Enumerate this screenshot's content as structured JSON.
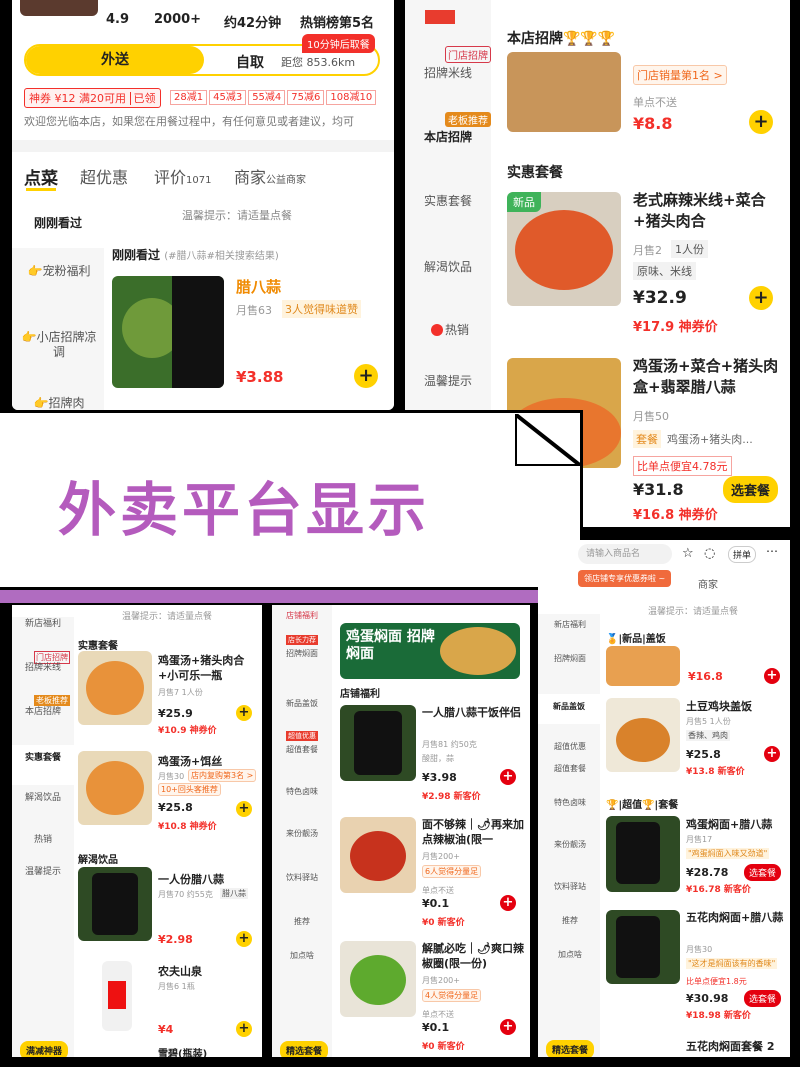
{
  "p1": {
    "stats": [
      "4.9",
      "2000+",
      "约42分钟",
      "热销榜第5名"
    ],
    "delivery_tab": "外送",
    "pickup_tab": "自取",
    "distance": "距您 853.6km",
    "pickup_badge": "10分钟后取餐",
    "coupon_main": "神券 ¥12 满20可用",
    "coupon_status": "已领",
    "discounts": [
      "28减1",
      "45减3",
      "55减4",
      "75减6",
      "108减10"
    ],
    "notice": "欢迎您光临本店，如果您在用餐过程中，有任何意见或者建议，均可",
    "tabs": [
      "点菜",
      "超优惠",
      "评价",
      "商家"
    ],
    "review_count": "1071",
    "merchant_sub": "公益商家",
    "sidebar": [
      "刚刚看过",
      "👉宠粉福利",
      "👉小店招牌凉调",
      "👉招牌肉"
    ],
    "hint": "温馨提示：请适量点餐",
    "section_title": "刚刚看过",
    "section_sub": "(#腊八蒜#相关搜索结果)",
    "item_name": "腊八蒜",
    "item_sales": "月售63",
    "item_tag": "3人觉得味道赞",
    "item_price": "¥3.88"
  },
  "p2": {
    "sidebar": [
      "门店招牌",
      "招牌米线",
      "老板推荐",
      "本店招牌",
      "实惠套餐",
      "解渴饮品",
      "热销",
      "温馨提示"
    ],
    "section1": "本店招牌🏆🏆🏆",
    "i1_tag": "门店销量第1名 >",
    "i1_note": "单点不送",
    "i1_price": "¥8.8",
    "section2": "实惠套餐",
    "i2_badge": "新品",
    "i2_name": "老式麻辣米线+菜合+猪头肉合",
    "i2_sales": "月售2",
    "i2_portion": "1人份",
    "i2_attr": "原味、米线",
    "i2_price": "¥32.9",
    "i2_coupon": "¥17.9 神券价",
    "i3_name": "鸡蛋汤+菜合+猪头肉盒+翡翠腊八蒜",
    "i3_sales": "月售50",
    "i3_set": "套餐",
    "i3_set_desc": "鸡蛋汤+猪头肉...",
    "i3_save": "比单点便宜4.78元",
    "i3_price": "¥31.8",
    "i3_coupon": "¥16.8 神券价",
    "i3_button": "选套餐"
  },
  "banner": {
    "title": "外卖平台显示"
  },
  "p3": {
    "hint": "温馨提示：请适量点餐",
    "sidebar": [
      "新店福利",
      "门店招牌",
      "招牌米线",
      "老板推荐",
      "本店招牌",
      "实惠套餐",
      "解渴饮品",
      "热销",
      "温馨提示"
    ],
    "section1": "实惠套餐",
    "i1_name": "鸡蛋汤+猪头肉合+小可乐一瓶",
    "i1_sales": "月售7 1人份",
    "i1_price": "¥25.9",
    "i1_coupon": "¥10.9 神券价",
    "i2_name": "鸡蛋汤+饵丝",
    "i2_sales": "月售30",
    "i2_tag": "店内复购第3名 >",
    "i2_tag2": "10+回头客推荐",
    "i2_price": "¥25.8",
    "i2_coupon": "¥10.8 神券价",
    "section2": "解渴饮品",
    "i3_name": "一人份腊八蒜",
    "i3_sales": "月售70 约55克",
    "i3_tag": "腊八蒜",
    "i3_price": "¥2.98",
    "i4_name": "农夫山泉",
    "i4_sales": "月售6 1瓶",
    "i4_price": "¥4",
    "bottom_btn": "满减神器",
    "bottom_next": "雪碧(瓶装)"
  },
  "p4": {
    "sidebar": [
      "店铺福利",
      "店长力荐",
      "招牌焖面",
      "新品盖饭",
      "超值优惠",
      "超值套餐",
      "特色卤味",
      "来份靓汤",
      "饮料驿站",
      "推荐",
      "加点啥"
    ],
    "banner_text": "鸡蛋焖面 招牌焖面",
    "section": "店铺福利",
    "i1_name": "一人腊八蒜干饭伴侣",
    "i1_sales": "月售81 约50克",
    "i1_attr": "酸甜，蒜",
    "i1_price": "¥3.98",
    "i1_coupon": "¥2.98 新客价",
    "i2_name": "面不够辣｜🌶再来加点辣椒油(限一",
    "i2_sales": "月售200+",
    "i2_tag": "6人觉得分量足",
    "i2_note": "单点不送",
    "i2_price": "¥0.1",
    "i2_coupon": "¥0 新客价",
    "i3_name": "解腻必吃｜🌶爽口辣椒圈(限一份)",
    "i3_sales": "月售200+",
    "i3_tag": "4人觉得分量足",
    "i3_note": "单点不送",
    "i3_price": "¥0.1",
    "i3_coupon": "¥0 新客价",
    "bottom_btn": "精选套餐"
  },
  "p5": {
    "search_placeholder": "请输入商品名",
    "tab_btn": "拼单",
    "promo": "领店铺专享优惠券啦 ~",
    "merchant": "商家",
    "hint": "温馨提示：请适量点餐",
    "sidebar": [
      "新店福利",
      "招牌焖面",
      "新品盖饭",
      "超值优惠",
      "超值套餐",
      "特色卤味",
      "来份靓汤",
      "饮料驿站",
      "推荐",
      "加点啥"
    ],
    "section1": "🏅|新品|盖饭",
    "i0_price": "¥16.8",
    "i1_name": "土豆鸡块盖饭",
    "i1_sales": "月售5 1人份",
    "i1_attr": "香辣、鸡肉",
    "i1_price": "¥25.8",
    "i1_coupon": "¥13.8 新客价",
    "section2": "🏆|超值🏆|套餐",
    "i2_name": "鸡蛋焖面+腊八蒜",
    "i2_sales": "月售17",
    "i2_tag": "\"鸡蛋焖面入味又劲道\"",
    "i2_price": "¥28.78",
    "i2_coupon": "¥16.78 新客价",
    "i2_btn": "选套餐",
    "i3_name": "五花肉焖面+腊八蒜",
    "i3_sales": "月售30",
    "i3_tag": "\"这才是焖面该有的香味\"",
    "i3_save": "比单点便宜1.8元",
    "i3_price": "¥30.98",
    "i3_coupon": "¥18.98 新客价",
    "i3_btn": "选套餐",
    "i4_name": "五花肉焖面套餐 2",
    "bottom_btn": "精选套餐"
  },
  "colors": {
    "accent": "#ffd100",
    "price": "#f3302a",
    "banner_text": "#b45bbd",
    "banner_stripe": "#b06cc0"
  }
}
